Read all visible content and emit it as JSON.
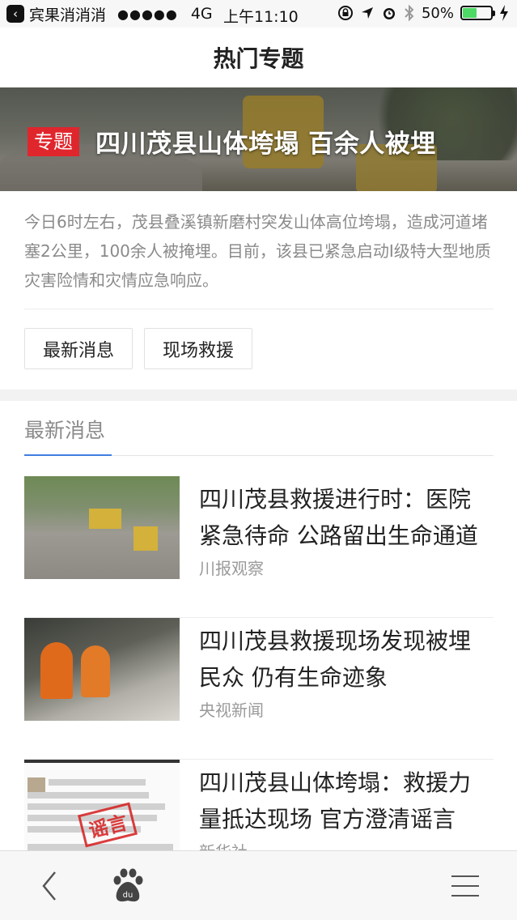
{
  "status_bar": {
    "carrier": "宾果消消消",
    "signal": "●●●●●",
    "network": "4G",
    "time": "上午11:10",
    "battery_percent": "50%",
    "battery_level": 0.5
  },
  "nav": {
    "title": "热门专题"
  },
  "banner": {
    "tag": "专题",
    "title": "四川茂县山体垮塌 百余人被埋"
  },
  "summary": "今日6时左右，茂县叠溪镇新磨村突发山体高位垮塌，造成河道堵塞2公里，100余人被掩埋。目前，该县已紧急启动I级特大型地质灾害险情和灾情应急响应。",
  "tabs": [
    {
      "label": "最新消息"
    },
    {
      "label": "现场救援"
    }
  ],
  "section": {
    "title": "最新消息"
  },
  "news": [
    {
      "title": "四川茂县救援进行时：医院紧急待命 公路留出生命通道",
      "source": "川报观察"
    },
    {
      "title": "四川茂县救援现场发现被埋民众 仍有生命迹象",
      "source": "央视新闻"
    },
    {
      "title": "四川茂县山体垮塌：救援力量抵达现场 官方澄清谣言",
      "source": "新华社",
      "stamp": "谣言"
    }
  ],
  "colors": {
    "accent": "#3f7fe0",
    "tag_red": "#e0262d",
    "battery_green": "#4cd964"
  },
  "toolbar": {
    "icons": [
      "back-arrow-icon",
      "baidu-paw-icon",
      "menu-icon"
    ]
  }
}
